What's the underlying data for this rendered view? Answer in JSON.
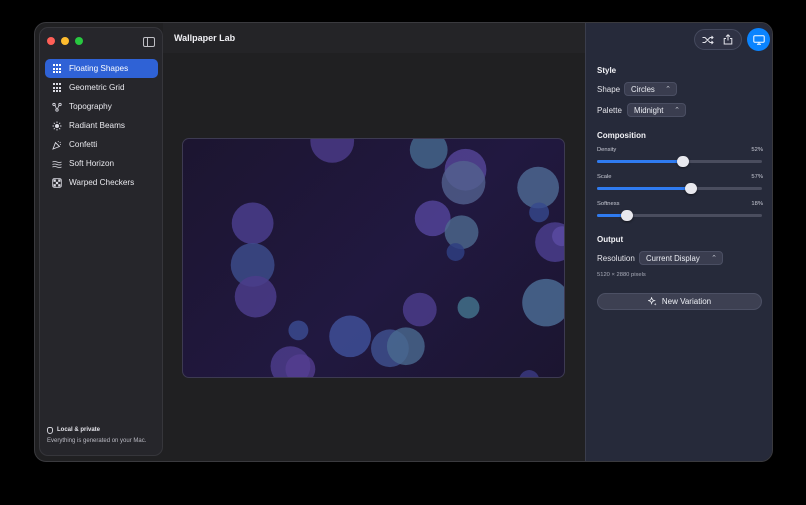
{
  "app": {
    "title": "Wallpaper Lab"
  },
  "sidebar": {
    "items": [
      {
        "label": "Floating Shapes",
        "icon": "grid-icon",
        "active": true
      },
      {
        "label": "Geometric Grid",
        "icon": "grid-icon",
        "active": false
      },
      {
        "label": "Topography",
        "icon": "nodes-icon",
        "active": false
      },
      {
        "label": "Radiant Beams",
        "icon": "sun-icon",
        "active": false
      },
      {
        "label": "Confetti",
        "icon": "party-popper-icon",
        "active": false
      },
      {
        "label": "Soft Horizon",
        "icon": "waves-icon",
        "active": false
      },
      {
        "label": "Warped Checkers",
        "icon": "checkerboard-icon",
        "active": false
      }
    ],
    "privacy": {
      "title": "Local & private",
      "text": "Everything is generated on your Mac."
    }
  },
  "inspector": {
    "style": {
      "title": "Style",
      "shape_label": "Shape",
      "shape_value": "Circles",
      "palette_label": "Palette",
      "palette_value": "Midnight"
    },
    "composition": {
      "title": "Composition",
      "sliders": [
        {
          "label": "Density",
          "value_text": "52%",
          "fraction": 0.52
        },
        {
          "label": "Scale",
          "value_text": "57%",
          "fraction": 0.57
        },
        {
          "label": "Softness",
          "value_text": "18%",
          "fraction": 0.18
        }
      ]
    },
    "output": {
      "title": "Output",
      "resolution_label": "Resolution",
      "resolution_value": "Current Display",
      "resolution_note": "5120 × 2880 pixels"
    },
    "new_variation_label": "New Variation"
  },
  "colors": {
    "accent": "#2f62d6",
    "slider_fill": "#2f7bf0",
    "canvas_bg": "#1f1738",
    "monitor_button": "#0a84ff"
  }
}
